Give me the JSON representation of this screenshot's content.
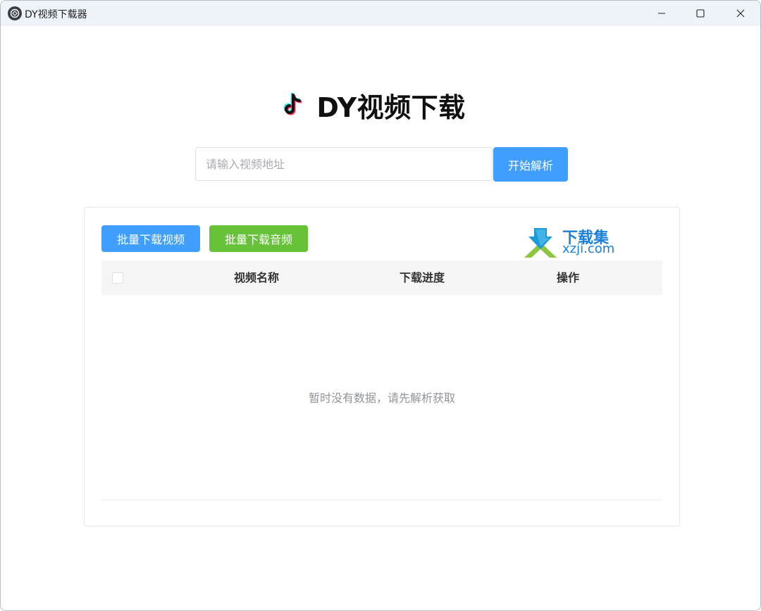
{
  "window": {
    "title": "DY视频下载器",
    "controls": {
      "minimize_icon": "minimize-icon",
      "maximize_icon": "maximize-icon",
      "close_icon": "close-icon"
    }
  },
  "header": {
    "title": "DY视频下载",
    "logo_icon": "tiktok-icon"
  },
  "search": {
    "value": "",
    "placeholder": "请输入视频地址",
    "button_label": "开始解析"
  },
  "actions": {
    "batch_video_label": "批量下载视频",
    "batch_audio_label": "批量下载音频"
  },
  "watermark": {
    "name": "下载集",
    "url": "xzji.com"
  },
  "table": {
    "columns": [
      "视频名称",
      "下载进度",
      "操作"
    ],
    "rows": [],
    "empty_text": "暂时没有数据，请先解析获取"
  },
  "colors": {
    "primary": "#409eff",
    "success": "#67c23a",
    "titlebar": "#eef2f9"
  }
}
